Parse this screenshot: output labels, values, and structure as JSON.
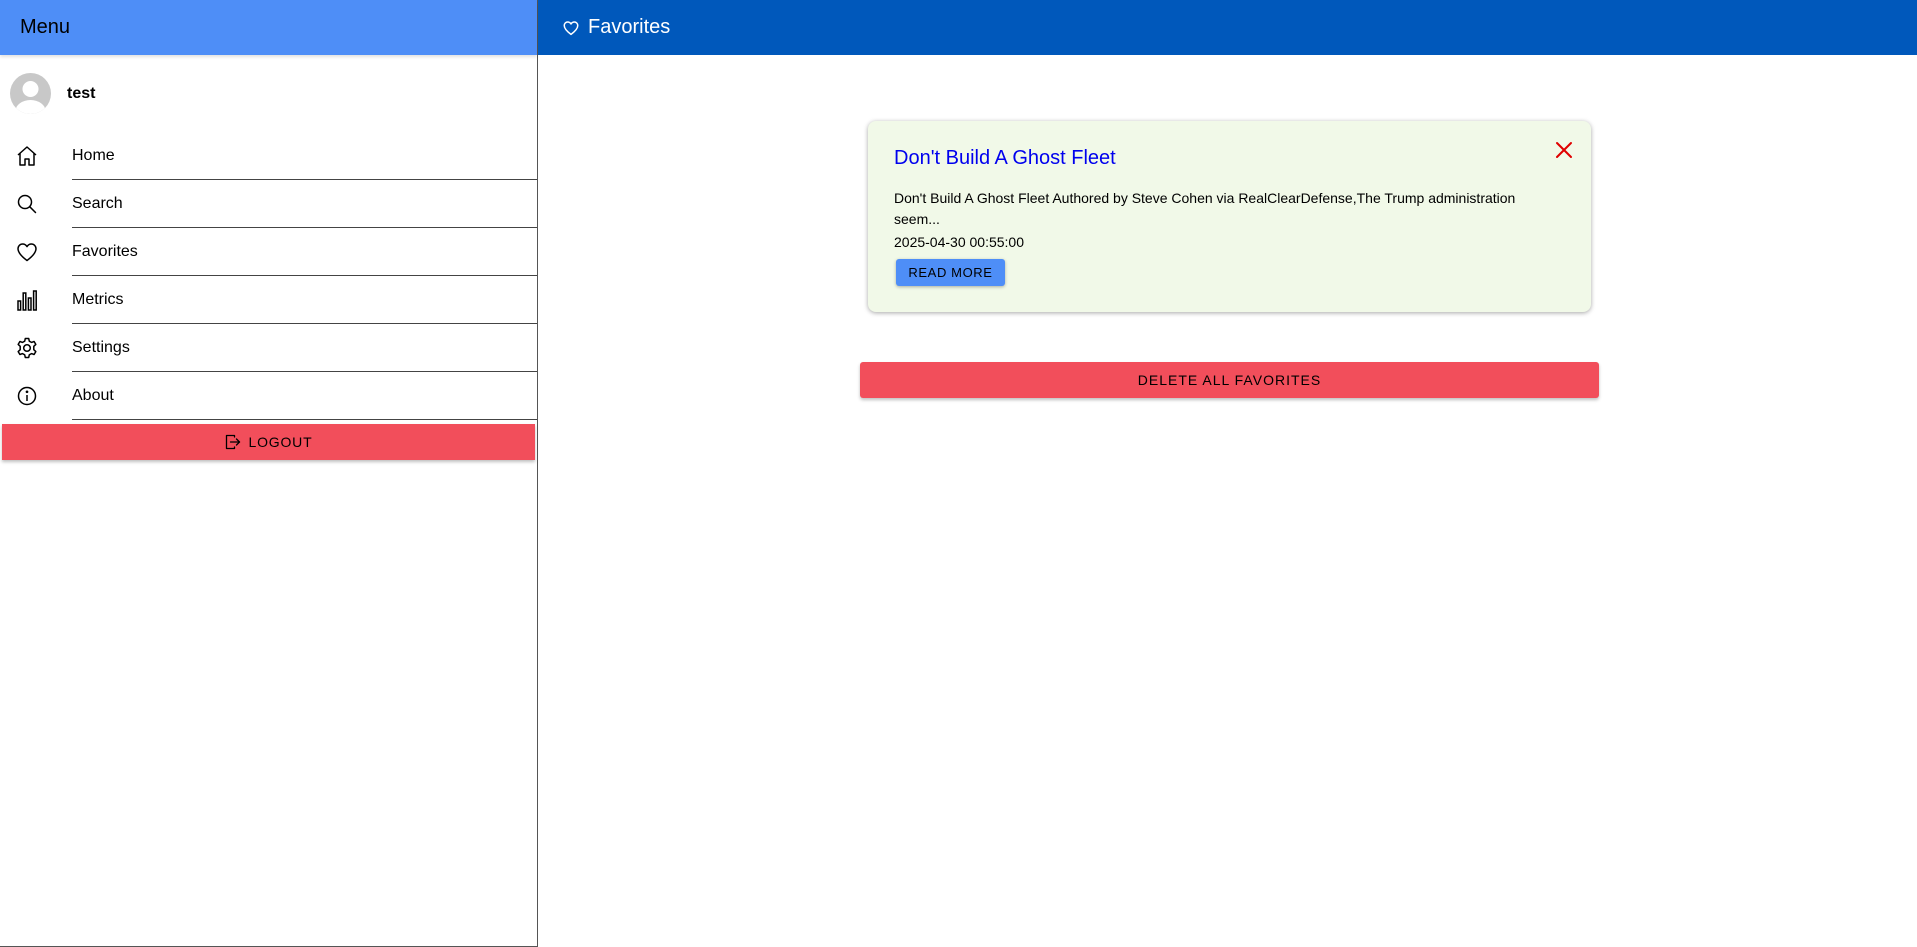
{
  "sidebar": {
    "title": "Menu",
    "user": {
      "name": "test"
    },
    "items": [
      {
        "label": "Home",
        "icon": "home-icon"
      },
      {
        "label": "Search",
        "icon": "search-icon"
      },
      {
        "label": "Favorites",
        "icon": "heart-icon"
      },
      {
        "label": "Metrics",
        "icon": "bar-chart-icon"
      },
      {
        "label": "Settings",
        "icon": "gear-icon"
      },
      {
        "label": "About",
        "icon": "info-icon"
      }
    ],
    "logout_label": "LOGOUT"
  },
  "header": {
    "title": "Favorites",
    "icon": "heart-icon"
  },
  "favorites": [
    {
      "title": "Don't Build A Ghost Fleet",
      "description": "Don't Build A Ghost Fleet Authored by Steve Cohen via RealClearDefense,The Trump administration seem...",
      "date": "2025-04-30 00:55:00",
      "read_more_label": "READ MORE"
    }
  ],
  "delete_all_label": "DELETE ALL FAVORITES",
  "colors": {
    "sidebar_header": "#4e8ef7",
    "topbar": "#0058bb",
    "danger": "#f24e5b",
    "primary_button": "#4e8ef7",
    "card_background": "#f1f9e8",
    "close_icon": "#e00000",
    "link": "#0000ee"
  }
}
